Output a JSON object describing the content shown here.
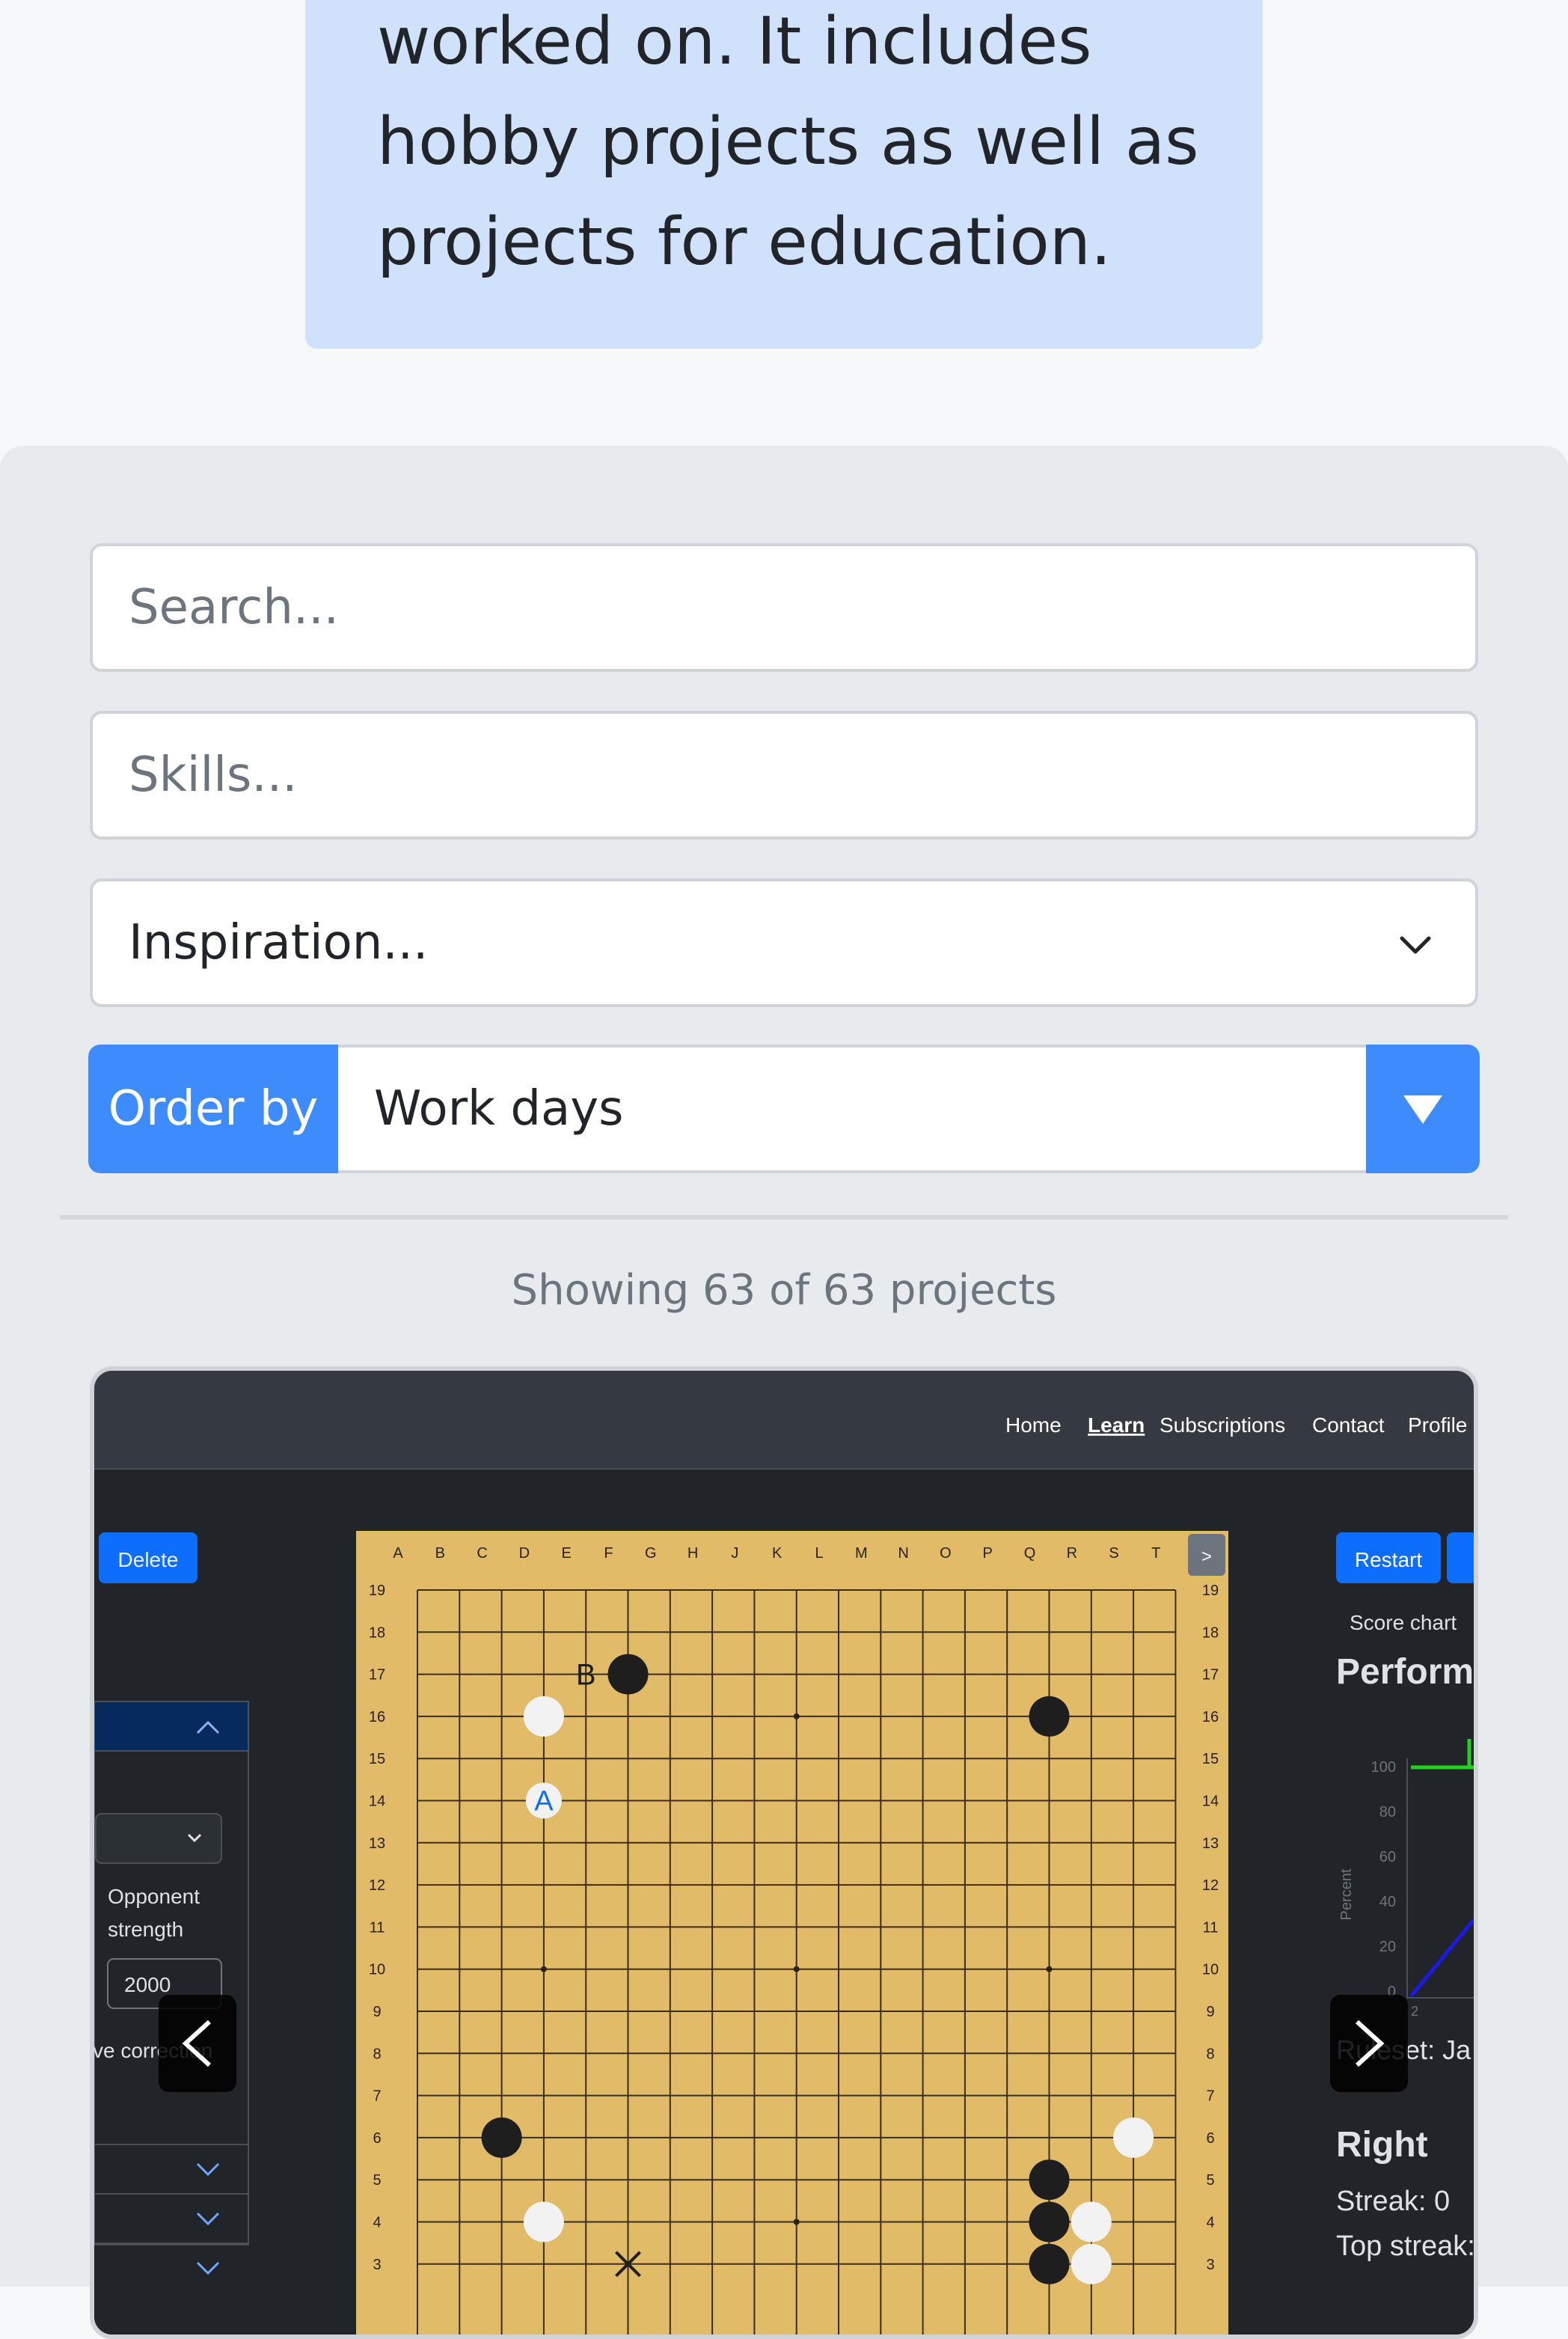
{
  "intro": {
    "line1": "worked on. It includes",
    "line2": "hobby projects as well as",
    "line3": "projects for education."
  },
  "filters": {
    "search_placeholder": "Search...",
    "skills_placeholder": "Skills...",
    "inspiration_value": "Inspiration...",
    "order_label": "Order by",
    "order_value": "Work days"
  },
  "result_count": "Showing 63 of 63 projects",
  "preview": {
    "nav": [
      "Home",
      "Learn",
      "Subscriptions",
      "Contact",
      "Profile"
    ],
    "nav_active": "Learn",
    "delete_label": "Delete",
    "restart_label": "Restart",
    "score_chart_label": "Score chart",
    "perform_title": "Perform",
    "percent_label": "Percent",
    "y_ticks": [
      "100",
      "80",
      "60",
      "40",
      "20",
      "0"
    ],
    "x_tick": "2",
    "opponent_label_1": "Opponent",
    "opponent_label_2": "strength",
    "opponent_value": "2000",
    "move_correction": "ve correction",
    "ruleset": "Ruleset: Ja",
    "right_title": "Right",
    "streak": "Streak: 0",
    "top_streak": "Top streak:",
    "board_columns": [
      "A",
      "B",
      "C",
      "D",
      "E",
      "F",
      "G",
      "H",
      "J",
      "K",
      "L",
      "M",
      "N",
      "O",
      "P",
      "Q",
      "R",
      "S",
      "T"
    ],
    "board_rows": [
      "19",
      "18",
      "17",
      "16",
      "15",
      "14",
      "13",
      "12",
      "11",
      "10",
      "9",
      "8",
      "7",
      "6",
      "5",
      "4",
      "3"
    ],
    "marker_a": "A",
    "marker_b": "B",
    "next_board_button": ">"
  },
  "colors": {
    "intro_bg": "#cfe1fb",
    "primary": "#3d8bfd",
    "board": "#e2bb69"
  }
}
